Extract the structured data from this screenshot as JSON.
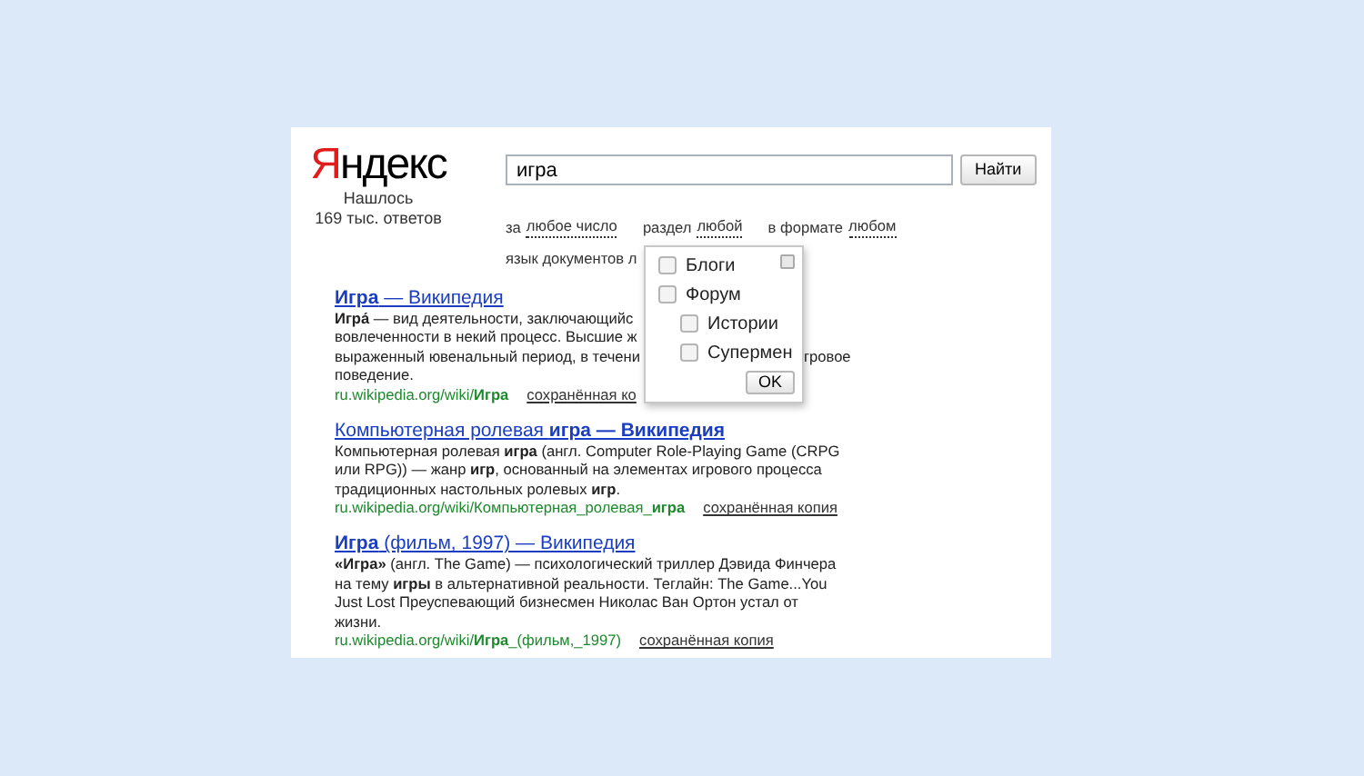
{
  "logo": {
    "first": "Я",
    "rest": "ндекс"
  },
  "found": [
    "Нашлось",
    "169 тыс. ответов"
  ],
  "search": {
    "value": "игра",
    "button": "Найти"
  },
  "filters": [
    {
      "prefix": "за",
      "link": "любое число"
    },
    {
      "prefix": "раздел",
      "link": "любой"
    },
    {
      "prefix": "в формате",
      "link": "любом"
    }
  ],
  "filters_row2": "язык документов л",
  "results": [
    {
      "title": "**Игра** — Википедия",
      "lines": [
        {
          "left": "**Игра́** — вид деятельности, заключающийс"
        },
        {
          "left": "вовлеченности в некий процесс. Высшие ж"
        },
        {
          "left": "выраженный ювенальный период, в течени",
          "right": "гровое"
        },
        {
          "left": "поведение."
        }
      ],
      "url": "ru.wikipedia.org/wiki/**Игра**",
      "copy": "сохранённая ко"
    },
    {
      "title": "Компьютерная ролевая **игра — Википедия**",
      "lines": [
        {
          "left": "Компьютерная ролевая **игра** (англ. Computer Role-Playing Game (CRPG"
        },
        {
          "left": "или RPG)) — жанр **игр**, основанный на элементах игрового процесса"
        },
        {
          "left": "традиционных настольных ролевых **игр**."
        }
      ],
      "url": "ru.wikipedia.org/wiki/Компьютерная_ролевая_**игра**",
      "copy": "сохранённая копия"
    },
    {
      "title": "**Игра** (фильм, 1997) — Википедия",
      "lines": [
        {
          "left": "**«Игра»** (англ. The Game) — психологический триллер Дэвида Финчера"
        },
        {
          "left": "на тему **игры** в альтернативной реальности. Теглайн: The Game...You"
        },
        {
          "left": "Just Lost Преуспевающий бизнесмен Николас Ван Ортон устал от"
        },
        {
          "left": "жизни."
        }
      ],
      "url": "ru.wikipedia.org/wiki/**Игра**_(фильм,_1997)",
      "copy": "сохранённая копия"
    }
  ],
  "popup": {
    "options": [
      {
        "label": "Блоги",
        "checked": false
      },
      {
        "label": "Форум",
        "checked": false,
        "children": [
          {
            "label": "Истории",
            "checked": false
          },
          {
            "label": "Супермен",
            "checked": false
          }
        ]
      }
    ],
    "ok": "OK"
  }
}
